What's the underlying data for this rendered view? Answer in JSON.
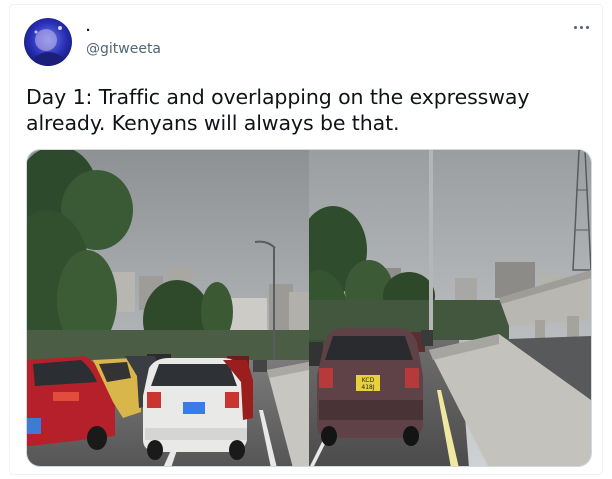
{
  "tweet": {
    "display_name": ".",
    "handle": "@gitweeta",
    "text": "Day 1: Traffic and overlapping on the expressway already. Kenyans will always be that.",
    "more_icon": "more-horizontal-icon"
  },
  "media": {
    "photos": [
      {
        "plate": ""
      },
      {
        "plate": "KCD 418J"
      }
    ]
  },
  "colors": {
    "text_primary": "#0f1419",
    "text_secondary": "#536471",
    "border": "#cfd9de"
  }
}
